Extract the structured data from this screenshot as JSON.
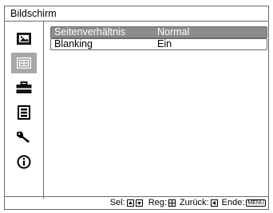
{
  "title": "Bildschirm",
  "sidebar": {
    "items": [
      {
        "icon": "picture-icon",
        "active": false
      },
      {
        "icon": "screen-icon",
        "active": true
      },
      {
        "icon": "toolbox-icon",
        "active": false
      },
      {
        "icon": "menu-list-icon",
        "active": false
      },
      {
        "icon": "wrench-icon",
        "active": false
      },
      {
        "icon": "info-icon",
        "active": false
      }
    ]
  },
  "settings": [
    {
      "label": "Seitenverhältnis",
      "value": "Normal",
      "selected": true
    },
    {
      "label": "Blanking",
      "value": "Ein",
      "selected": false
    }
  ],
  "footer": {
    "sel_label": "Sel:",
    "reg_label": "Reg:",
    "back_label": "Zurück:",
    "end_label": "Ende:",
    "menu_key": "MENU"
  },
  "colors": {
    "selected_bg": "#8c8c8c",
    "active_icon_bg": "#a8a8a8",
    "border": "#6b6b6b"
  }
}
